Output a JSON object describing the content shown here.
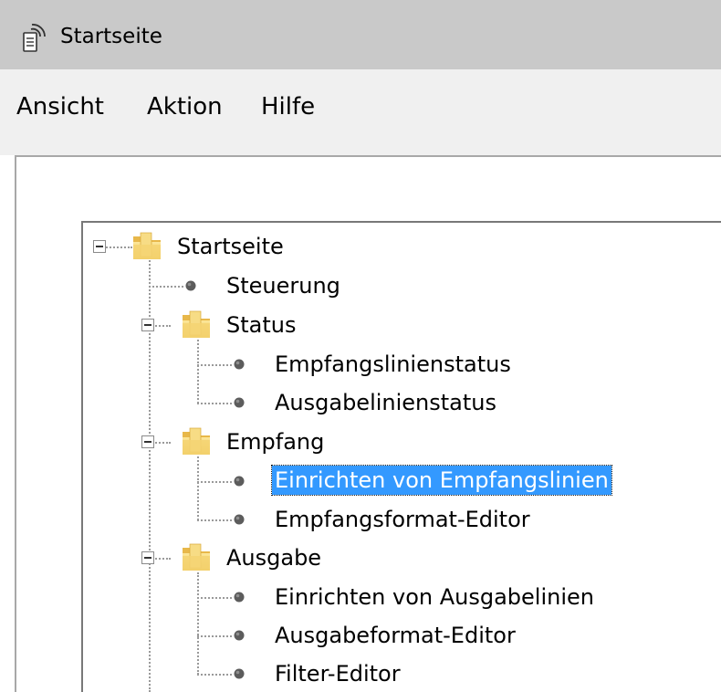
{
  "window": {
    "title": "Startseite",
    "icon": "remote-receiver-icon"
  },
  "menu": {
    "items": [
      "Ansicht",
      "Aktion",
      "Hilfe"
    ]
  },
  "tree": {
    "root": "Startseite",
    "steuerung": "Steuerung",
    "status": {
      "label": "Status",
      "children": [
        "Empfangslinienstatus",
        "Ausgabelinienstatus"
      ]
    },
    "empfang": {
      "label": "Empfang",
      "children": [
        "Einrichten von Empfangslinien",
        "Empfangsformat-Editor"
      ]
    },
    "ausgabe": {
      "label": "Ausgabe",
      "children": [
        "Einrichten von Ausgabelinien",
        "Ausgabeformat-Editor",
        "Filter-Editor"
      ]
    },
    "selected": "Einrichten von Empfangslinien"
  },
  "colors": {
    "selection": "#3399ff",
    "titlebar": "#c9c9c9",
    "menubar": "#f0f0f0",
    "folder": "#f2cf6a"
  }
}
